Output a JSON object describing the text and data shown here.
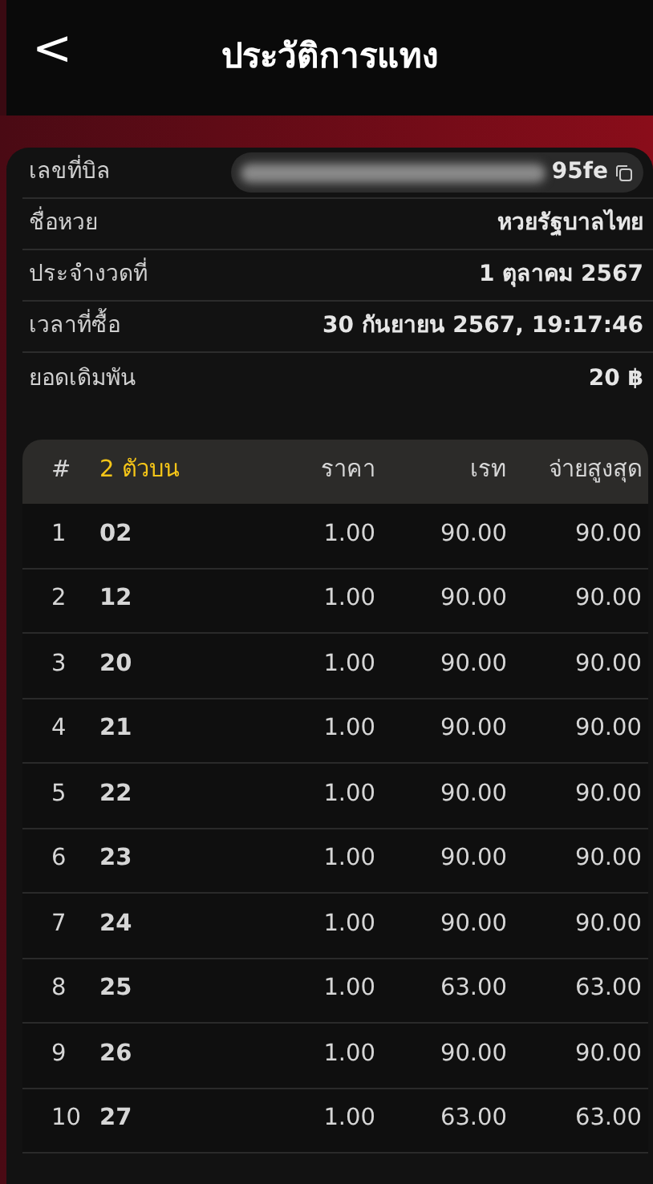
{
  "header": {
    "back": "<",
    "title": "ประวัติการแทง"
  },
  "details": [
    {
      "kind": "bill",
      "label": "เลขที่บิล",
      "value": "95fe"
    },
    {
      "kind": "text",
      "label": "ชื่อหวย",
      "value": "หวยรัฐบาลไทย"
    },
    {
      "kind": "text",
      "label": "ประจำงวดที่",
      "value": "1 ตุลาคม 2567"
    },
    {
      "kind": "text",
      "label": "เวลาที่ซื้อ",
      "value": "30 กันยายน 2567, 19:17:46"
    },
    {
      "kind": "text",
      "label": "ยอดเดิมพัน",
      "value": "20 ฿"
    }
  ],
  "table": {
    "columns": [
      "#",
      "2 ตัวบน",
      "ราคา",
      "เรท",
      "จ่ายสูงสุด"
    ],
    "rows": [
      [
        "1",
        "02",
        "1.00",
        "90.00",
        "90.00"
      ],
      [
        "2",
        "12",
        "1.00",
        "90.00",
        "90.00"
      ],
      [
        "3",
        "20",
        "1.00",
        "90.00",
        "90.00"
      ],
      [
        "4",
        "21",
        "1.00",
        "90.00",
        "90.00"
      ],
      [
        "5",
        "22",
        "1.00",
        "90.00",
        "90.00"
      ],
      [
        "6",
        "23",
        "1.00",
        "90.00",
        "90.00"
      ],
      [
        "7",
        "24",
        "1.00",
        "90.00",
        "90.00"
      ],
      [
        "8",
        "25",
        "1.00",
        "63.00",
        "63.00"
      ],
      [
        "9",
        "26",
        "1.00",
        "90.00",
        "90.00"
      ],
      [
        "10",
        "27",
        "1.00",
        "63.00",
        "63.00"
      ]
    ]
  }
}
